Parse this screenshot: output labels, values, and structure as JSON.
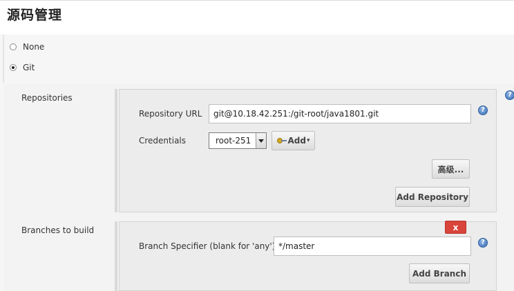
{
  "section": {
    "title": "源码管理"
  },
  "scm": {
    "options": [
      {
        "label": "None",
        "selected": false
      },
      {
        "label": "Git",
        "selected": true
      }
    ]
  },
  "repositories": {
    "label": "Repositories",
    "url_label": "Repository URL",
    "url_value": "git@10.18.42.251:/git-root/java1801.git",
    "credentials_label": "Credentials",
    "credentials_value": "root-251",
    "add_label": "Add",
    "advanced_label": "高级...",
    "add_repository_label": "Add Repository"
  },
  "branches": {
    "label": "Branches to build",
    "delete_label": "x",
    "specifier_label": "Branch Specifier (blank for 'any')",
    "specifier_value": "*/master",
    "add_branch_label": "Add Branch"
  },
  "help": {
    "glyph": "?"
  },
  "colors": {
    "help_icon": "#3a6fb5",
    "delete_button": "#d9453a"
  }
}
